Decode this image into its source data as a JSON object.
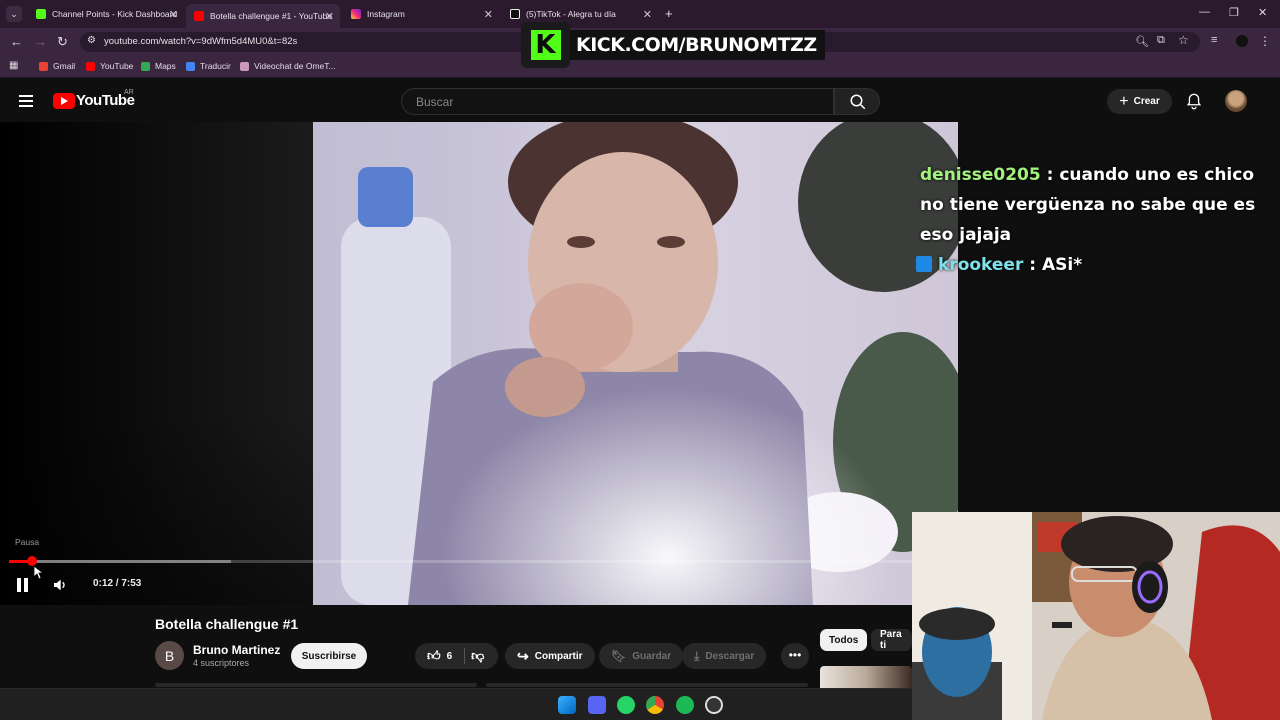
{
  "browser": {
    "tabs": [
      {
        "title": "Channel Points - Kick Dashboard",
        "favicon": "kick-icon",
        "color": "#53fc18",
        "active": false
      },
      {
        "title": "Botella challengue #1 - YouTube",
        "favicon": "youtube-icon",
        "color": "#ff0000",
        "active": true
      },
      {
        "title": "Instagram",
        "favicon": "instagram-icon",
        "color": "#e1306c",
        "active": false
      },
      {
        "title": "(5)TikTok - Alegra tu día",
        "favicon": "tiktok-icon",
        "color": "#ffffff",
        "active": false
      }
    ],
    "url": "youtube.com/watch?v=9dWfm5d4MU0&t=82s",
    "bookmarks": [
      {
        "label": "Gmail",
        "color": "#ea4335"
      },
      {
        "label": "YouTube",
        "color": "#ff0000"
      },
      {
        "label": "Maps",
        "color": "#34a853"
      },
      {
        "label": "Traducir",
        "color": "#4285f4"
      },
      {
        "label": "Videochat de OmeT...",
        "color": "#e8e0ea"
      }
    ]
  },
  "overlay": {
    "kick_url": "KICK.COM/BRUNOMTZZ",
    "kick_logo": "K",
    "brand_color": "#53fc18"
  },
  "youtube": {
    "logo_text": "YouTube",
    "country": "AR",
    "search_placeholder": "Buscar",
    "create_label": "Crear"
  },
  "player": {
    "tooltip": "Pausa",
    "time": "0:12 / 7:53",
    "progress": 0.0254,
    "buffered": 0.246
  },
  "chat": [
    {
      "user": "denisse0205",
      "message": " : cuando uno es chico no tiene vergüenza no sabe que es eso jajaja",
      "badge": false
    },
    {
      "user": "krookeer",
      "message": " : ASi*",
      "badge": true
    }
  ],
  "video": {
    "title": "Botella challengue #1",
    "channel_initial": "B",
    "channel": "Bruno Martinez",
    "subscribers": "4 suscriptores",
    "subscribe_label": "Suscribirse",
    "likes": "6",
    "share_label": "Compartir",
    "save_label": "Guardar",
    "download_label": "Descargar"
  },
  "filters": [
    "Todos",
    "Para ti"
  ]
}
